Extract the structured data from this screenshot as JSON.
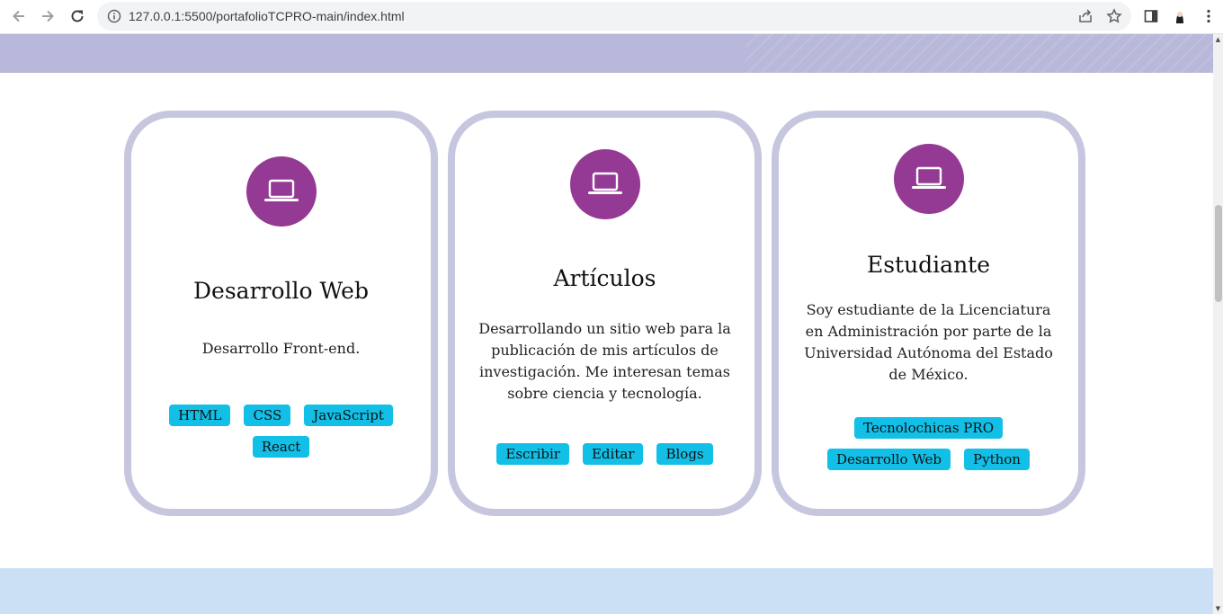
{
  "browser": {
    "url": "127.0.0.1:5500/portafolioTCPRO-main/index.html",
    "icons": [
      "back-arrow-icon",
      "forward-arrow-icon",
      "reload-icon",
      "info-icon",
      "share-icon",
      "star-icon",
      "side-panel-icon",
      "profile-icon",
      "kebab-menu-icon"
    ]
  },
  "cards": [
    {
      "icon": "laptop-icon",
      "title": "Desarrollo Web",
      "description": "Desarrollo Front-end.",
      "tags": [
        "HTML",
        "CSS",
        "JavaScript",
        "React"
      ]
    },
    {
      "icon": "laptop-icon",
      "title": "Artículos",
      "description": "Desarrollando un sitio web para la publicación de mis artículos de investigación. Me interesan temas sobre ciencia y tecnología.",
      "tags": [
        "Escribir",
        "Editar",
        "Blogs"
      ]
    },
    {
      "icon": "laptop-icon",
      "title": "Estudiante",
      "description": "Soy estudiante de la Licenciatura en Administración por parte de la Universidad Autónoma del Estado de México.",
      "tags": [
        "Tecnolochicas PRO",
        "Desarrollo Web",
        "Python"
      ]
    }
  ],
  "colors": {
    "top_band": "#b8b8da",
    "card_border": "#c7c6df",
    "icon_circle": "#943a94",
    "tag_bg": "#12bfe7",
    "bottom_band": "#cce0f5"
  }
}
